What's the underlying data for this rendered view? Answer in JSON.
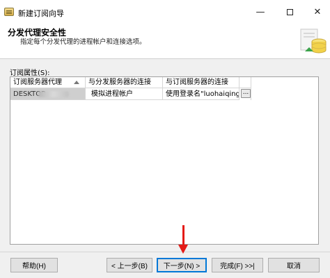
{
  "window": {
    "title": "新建订阅向导",
    "minimize_glyph": "—",
    "close_glyph": "✕"
  },
  "header": {
    "title": "分发代理安全性",
    "subtitle": "指定每个分发代理的进程帐户和连接选项。"
  },
  "grid": {
    "label": "订阅属性(S):",
    "columns": [
      "订阅服务器代理",
      "与分发服务器的连接",
      "与订阅服务器的连接"
    ],
    "rows": [
      {
        "subscriber": "DESKTOP-",
        "distributor_connection": "模拟进程帐户",
        "subscriber_connection": "使用登录名\"luohaiqing\"",
        "action": "..."
      }
    ]
  },
  "buttons": {
    "help": "帮助(H)",
    "prev": "< 上一步(B)",
    "next": "下一步(N) >",
    "finish": "完成(F) >>|",
    "cancel": "取消"
  },
  "icons": {
    "app": "document-icon",
    "wizard": "database-icon",
    "sort": "sort-ascending-icon",
    "annotation": "red-arrow-annotation"
  },
  "colors": {
    "accent": "#0078d7",
    "annotation": "#e41b17",
    "row_header": "#cfcfcf"
  }
}
